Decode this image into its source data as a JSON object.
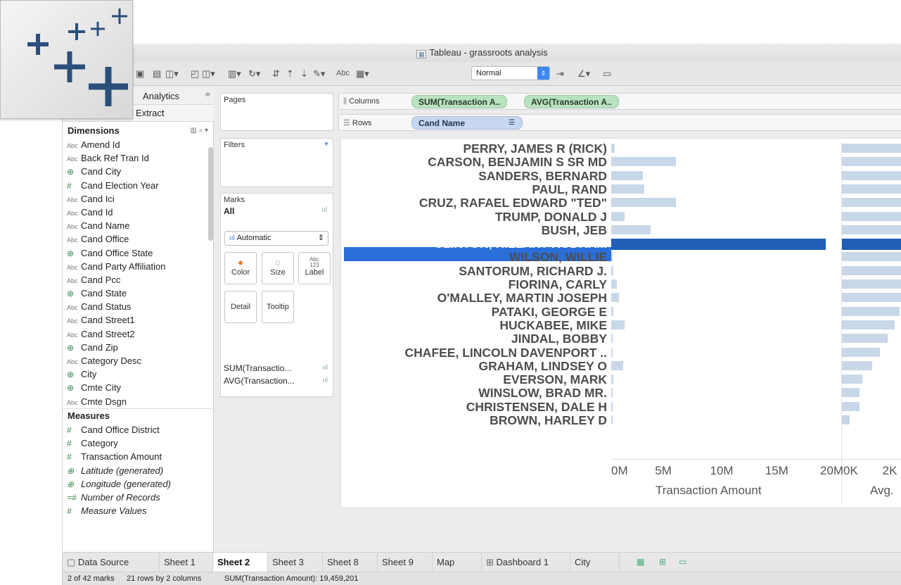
{
  "window": {
    "title": "Tableau - grassroots analysis"
  },
  "toolbar": {
    "mark_size_select": "Normal",
    "text_icon": "Abc"
  },
  "left_pane": {
    "tab_analytics": "Analytics",
    "extract": "Extract",
    "dimensions_header": "Dimensions",
    "dimensions": [
      {
        "icon": "Abc",
        "label": "Amend Id"
      },
      {
        "icon": "Abc",
        "label": "Back Ref Tran Id"
      },
      {
        "icon": "geo",
        "label": "Cand City"
      },
      {
        "icon": "#",
        "label": "Cand Election Year"
      },
      {
        "icon": "Abc",
        "label": "Cand Ici"
      },
      {
        "icon": "Abc",
        "label": "Cand Id"
      },
      {
        "icon": "Abc",
        "label": "Cand Name"
      },
      {
        "icon": "Abc",
        "label": "Cand Office"
      },
      {
        "icon": "geo",
        "label": "Cand Office State"
      },
      {
        "icon": "Abc",
        "label": "Cand Party Affiliation"
      },
      {
        "icon": "Abc",
        "label": "Cand Pcc"
      },
      {
        "icon": "geo",
        "label": "Cand State"
      },
      {
        "icon": "Abc",
        "label": "Cand Status"
      },
      {
        "icon": "Abc",
        "label": "Cand Street1"
      },
      {
        "icon": "Abc",
        "label": "Cand Street2"
      },
      {
        "icon": "geo",
        "label": "Cand Zip"
      },
      {
        "icon": "Abc",
        "label": "Category Desc"
      },
      {
        "icon": "geo",
        "label": "City"
      },
      {
        "icon": "geo",
        "label": "Cmte City"
      },
      {
        "icon": "Abc",
        "label": "Cmte Dsgn"
      }
    ],
    "measures_header": "Measures",
    "measures": [
      {
        "icon": "#",
        "label": "Cand Office District"
      },
      {
        "icon": "#",
        "label": "Category"
      },
      {
        "icon": "#",
        "label": "Transaction Amount"
      },
      {
        "icon": "geo",
        "label": "Latitude (generated)"
      },
      {
        "icon": "geo",
        "label": "Longitude (generated)"
      },
      {
        "icon": "=#",
        "label": "Number of Records"
      },
      {
        "icon": "#",
        "label": "Measure Values"
      }
    ]
  },
  "cards": {
    "pages": "Pages",
    "filters": "Filters",
    "marks": "Marks",
    "marks_all": "All",
    "mark_type": "Automatic",
    "color": "Color",
    "size": "Size",
    "label": "Label",
    "label_glyph": "Abc\n123",
    "detail": "Detail",
    "tooltip": "Tooltip",
    "measure1": "SUM(Transactio...",
    "measure2": "AVG(Transaction..."
  },
  "shelves": {
    "columns_label": "Columns",
    "rows_label": "Rows",
    "columns_pills": [
      "SUM(Transaction A..",
      "AVG(Transaction A.."
    ],
    "rows_pill": "Cand Name"
  },
  "chart_data": {
    "type": "bar",
    "categories": [
      "PERRY, JAMES R (RICK)",
      "CARSON, BENJAMIN S SR MD",
      "SANDERS, BERNARD",
      "PAUL, RAND",
      "CRUZ, RAFAEL EDWARD \"TED\"",
      "TRUMP, DONALD J",
      "BUSH, JEB",
      "CLINTON, HILLARY RODHAM",
      "WILSON, WILLIE",
      "SANTORUM, RICHARD J.",
      "FIORINA, CARLY",
      "O'MALLEY, MARTIN JOSEPH",
      "PATAKI, GEORGE E",
      "HUCKABEE, MIKE",
      "JINDAL, BOBBY",
      "CHAFEE, LINCOLN DAVENPORT ..",
      "GRAHAM, LINDSEY O",
      "EVERSON, MARK",
      "WINSLOW, BRAD MR.",
      "CHRISTENSEN, DALE H",
      "BROWN, HARLEY D"
    ],
    "selected_index": 7,
    "series": [
      {
        "name": "Transaction Amount",
        "values": [
          0.3,
          5.9,
          2.9,
          3.0,
          5.9,
          1.2,
          3.6,
          19.46,
          0.05,
          0.2,
          0.5,
          0.7,
          0.2,
          1.2,
          0.1,
          0.05,
          1.1,
          0.2,
          0.05,
          0.05,
          0.05
        ]
      },
      {
        "name": "Avg.",
        "values": [
          2400,
          2400,
          2400,
          2400,
          2400,
          2400,
          2400,
          2400,
          2400,
          2350,
          2350,
          2350,
          2300,
          2100,
          1800,
          1500,
          1200,
          800,
          700,
          700,
          300
        ]
      }
    ],
    "x_axis_1": {
      "ticks": [
        "0M",
        "5M",
        "10M",
        "15M",
        "20M"
      ],
      "tick_values": [
        0,
        5,
        10,
        15,
        20
      ],
      "range": [
        0,
        20
      ],
      "title": "Transaction Amount"
    },
    "x_axis_2": {
      "ticks": [
        "0K",
        "2K"
      ],
      "tick_values": [
        0,
        2000
      ],
      "range": [
        0,
        2400
      ],
      "title": "Avg."
    }
  },
  "sheet_tabs": [
    "Data Source",
    "Sheet 1",
    "Sheet 2",
    "Sheet 3",
    "Sheet 8",
    "Sheet 9",
    "Map",
    "Dashboard 1",
    "City"
  ],
  "active_tab": "Sheet 2",
  "status": {
    "marks": "2 of 42 marks",
    "dims": "21 rows by 2 columns",
    "sum": "SUM(Transaction Amount): 19,459,201"
  }
}
